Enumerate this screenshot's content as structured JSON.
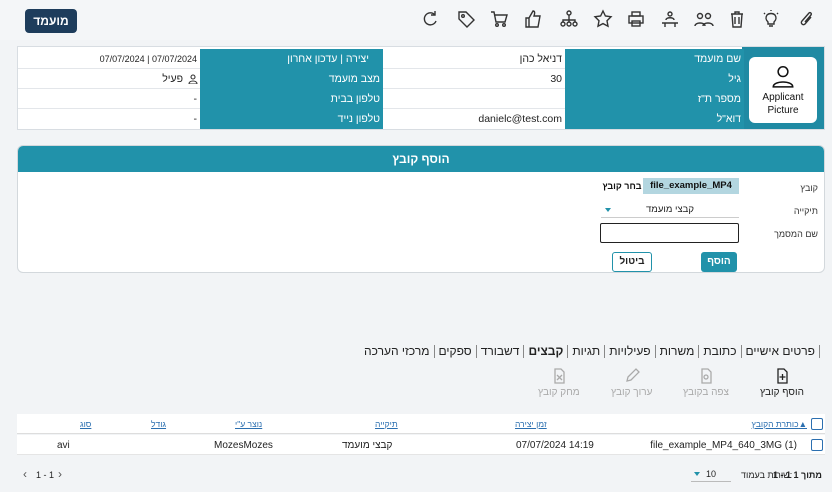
{
  "toolbar": {
    "candidate_label": "מועמד",
    "icons": [
      "paperclip-icon",
      "lightbulb-icon",
      "trash-icon",
      "people-icon",
      "meeting-icon",
      "print-icon",
      "star-icon",
      "hierarchy-icon",
      "thumbs-up-icon",
      "cart-icon",
      "tag-icon",
      "refresh-icon"
    ]
  },
  "profile": {
    "picture_label_1": "Applicant",
    "picture_label_2": "Picture",
    "rows": [
      {
        "label_a": "שם מועמד",
        "value_a": "דניאל כהן",
        "label_b": "יצירה | עדכון אחרון",
        "value_b": "07/07/2024 | 07/07/2024"
      },
      {
        "label_a": "גיל",
        "value_a": "30",
        "label_b": "מצב מועמד",
        "value_b": "פעיל"
      },
      {
        "label_a": "מספר ת\"ז",
        "value_a": "",
        "label_b": "טלפון בבית",
        "value_b": "-"
      },
      {
        "label_a": "דוא\"ל",
        "value_a": "danielc@test.com",
        "label_b": "טלפון נייד",
        "value_b": "-"
      }
    ]
  },
  "add_file": {
    "title": "הוסף קובץ",
    "file_label": "קובץ",
    "file_name": "file_example_MP4",
    "choose_label": "בחר קובץ",
    "folder_label": "תיקייה",
    "folder_value": "קבצי מועמד",
    "docname_label": "שם המסמך",
    "docname_value": "",
    "add_button": "הוסף",
    "cancel_button": "ביטול"
  },
  "tabs": [
    "פרטים אישיים",
    "כתובת",
    "משרות",
    "פעילויות",
    "תגיות",
    "קבצים",
    "דשבורד",
    "ספקים",
    "מרכזי הערכה"
  ],
  "active_tab": "קבצים",
  "actions": {
    "add": "הוסף קובץ",
    "view": "צפה בקובץ",
    "edit": "ערוך קובץ",
    "delete": "מחק קובץ"
  },
  "table": {
    "headers": {
      "title": "כותרת הקובץ",
      "created": "זמן יצירה",
      "folder": "תיקייה",
      "creator": "נוצר ע\"י",
      "size": "גודל",
      "type": "סוג"
    },
    "rows": [
      {
        "title": "file_example_MP4_640_3MG (1)",
        "created": "07/07/2024 14:19",
        "folder": "קבצי מועמד",
        "creator": "MozesMozes",
        "size": "",
        "type": "avi"
      }
    ]
  },
  "pager": {
    "summary": "1 - 1 מתוך 1",
    "rows_label": "שורות בעמוד:",
    "rows_value": "10",
    "range": "1 - 1"
  },
  "colors": {
    "accent": "#2192aa",
    "brand": "#1e3d5c"
  }
}
